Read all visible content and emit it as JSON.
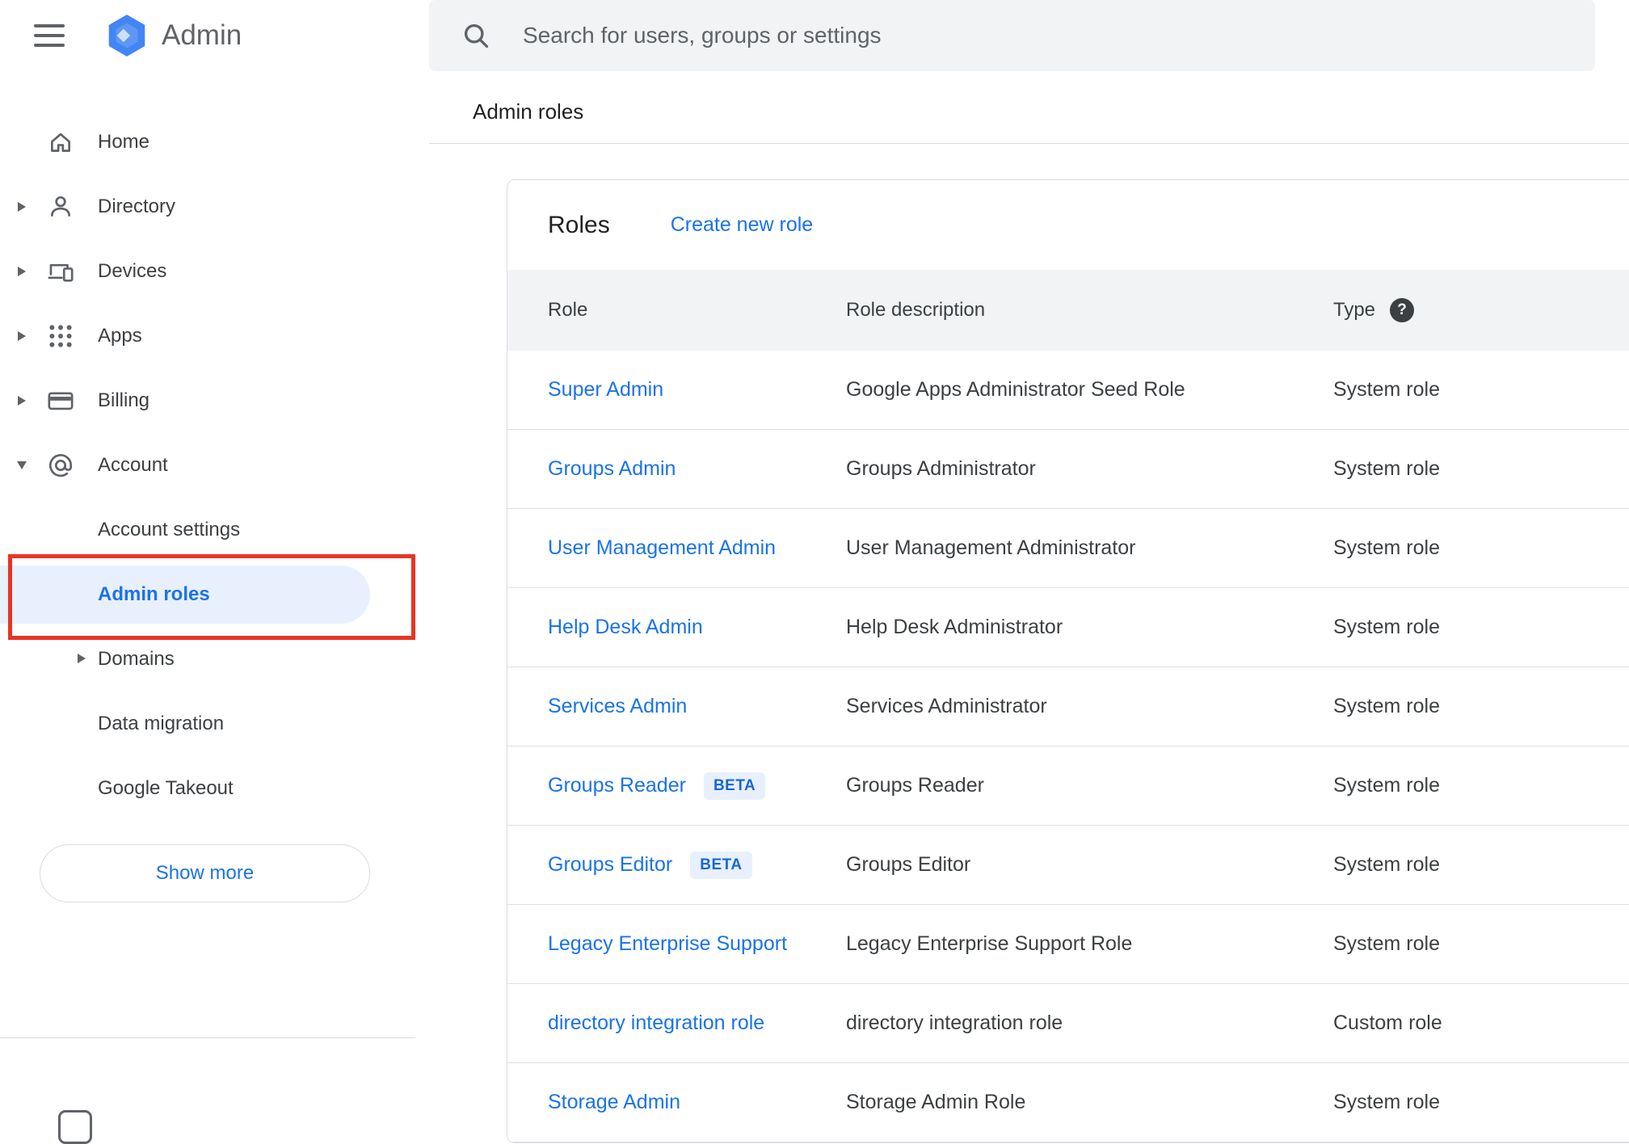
{
  "colors": {
    "accent_blue": "#1a73e8",
    "link_blue": "#1a73e8",
    "selected_item_bg": "#e8f0fe",
    "table_header_bg": "#f1f3f4",
    "search_bar_bg": "#f1f3f4",
    "annotation_red": "#ea3323",
    "beta_badge_bg": "#e8f0fe",
    "beta_badge_text": "#1967d2"
  },
  "header": {
    "menu_icon": "hamburger-icon",
    "logo_icon": "admin-hexagon-logo",
    "app_name": "Admin",
    "search_icon": "search-icon",
    "search_placeholder": "Search for users, groups or settings",
    "breadcrumb": "Admin roles"
  },
  "sidebar": {
    "items": [
      {
        "label": "Home",
        "icon": "home-icon",
        "arrow": "none"
      },
      {
        "label": "Directory",
        "icon": "person-icon",
        "arrow": "collapsed"
      },
      {
        "label": "Devices",
        "icon": "devices-icon",
        "arrow": "collapsed"
      },
      {
        "label": "Apps",
        "icon": "apps-grid-icon",
        "arrow": "collapsed"
      },
      {
        "label": "Billing",
        "icon": "billing-card-icon",
        "arrow": "collapsed"
      },
      {
        "label": "Account",
        "icon": "at-sign-icon",
        "arrow": "expanded"
      }
    ],
    "sub_items": [
      {
        "label": "Account settings",
        "selected": false,
        "arrow": "none",
        "annotated": false
      },
      {
        "label": "Admin roles",
        "selected": true,
        "arrow": "none",
        "annotated": true
      },
      {
        "label": "Domains",
        "selected": false,
        "arrow": "collapsed",
        "annotated": false
      },
      {
        "label": "Data migration",
        "selected": false,
        "arrow": "none",
        "annotated": false
      },
      {
        "label": "Google Takeout",
        "selected": false,
        "arrow": "none",
        "annotated": false
      }
    ],
    "show_more": "Show more"
  },
  "main": {
    "title": "Roles",
    "create_link": "Create new role",
    "table": {
      "columns": [
        "Role",
        "Role description",
        "Type"
      ],
      "type_help_icon": "help-icon",
      "rows": [
        {
          "role": "Super Admin",
          "badge": "",
          "description": "Google Apps Administrator Seed Role",
          "type": "System role"
        },
        {
          "role": "Groups Admin",
          "badge": "",
          "description": "Groups Administrator",
          "type": "System role"
        },
        {
          "role": "User Management Admin",
          "badge": "",
          "description": "User Management Administrator",
          "type": "System role"
        },
        {
          "role": "Help Desk Admin",
          "badge": "",
          "description": "Help Desk Administrator",
          "type": "System role"
        },
        {
          "role": "Services Admin",
          "badge": "",
          "description": "Services Administrator",
          "type": "System role"
        },
        {
          "role": "Groups Reader",
          "badge": "BETA",
          "description": "Groups Reader",
          "type": "System role"
        },
        {
          "role": "Groups Editor",
          "badge": "BETA",
          "description": "Groups Editor",
          "type": "System role"
        },
        {
          "role": "Legacy Enterprise Support",
          "badge": "",
          "description": "Legacy Enterprise Support Role",
          "type": "System role"
        },
        {
          "role": "directory integration role",
          "badge": "",
          "description": "directory integration role",
          "type": "Custom role"
        },
        {
          "role": "Storage Admin",
          "badge": "",
          "description": "Storage Admin Role",
          "type": "System role"
        }
      ]
    }
  }
}
